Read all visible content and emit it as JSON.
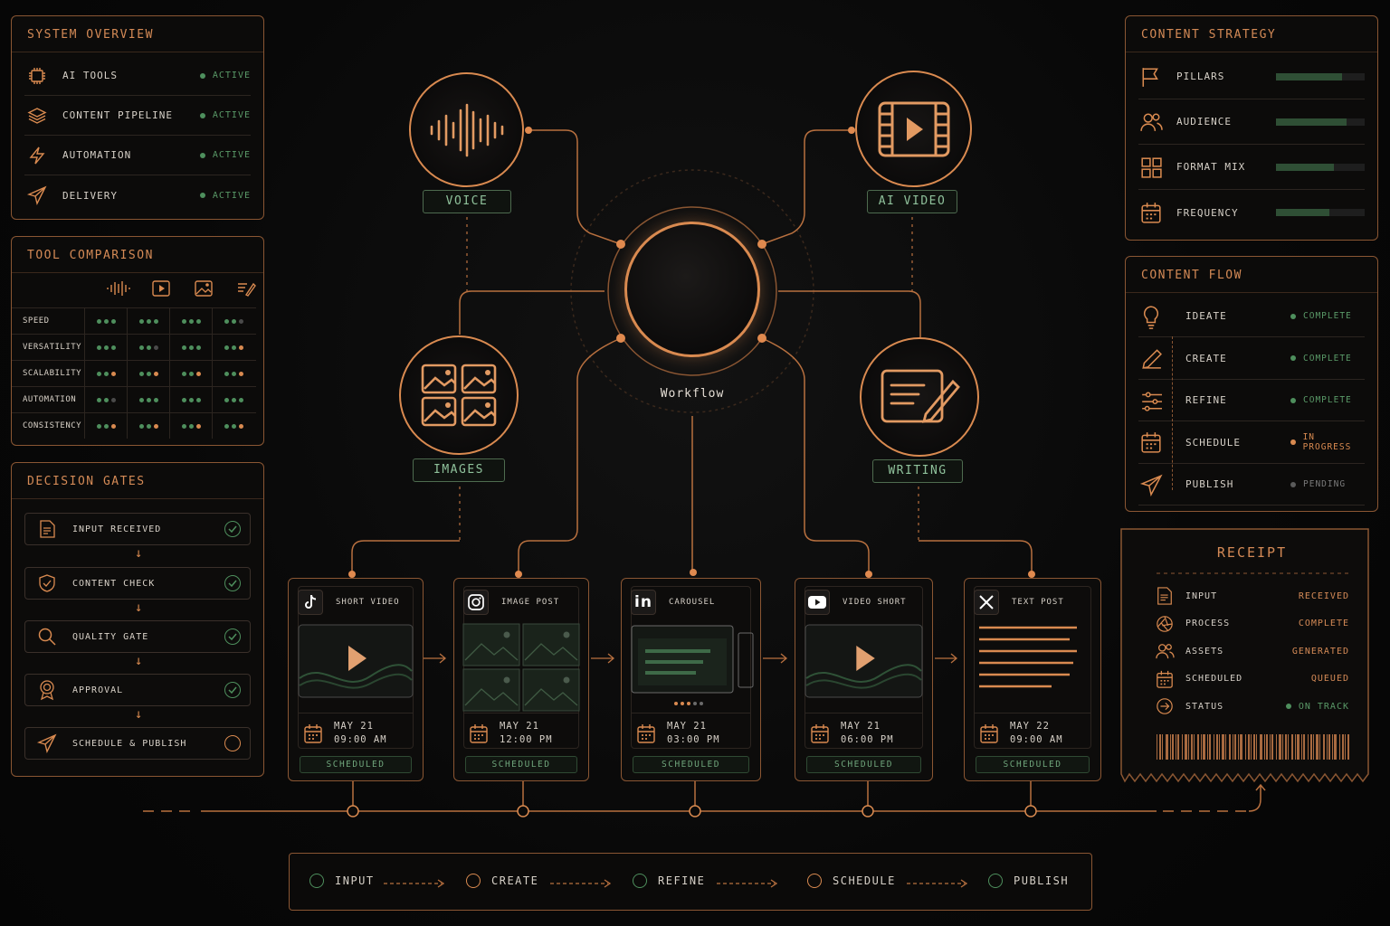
{
  "system_overview": {
    "title": "SYSTEM OVERVIEW",
    "items": [
      {
        "label": "AI TOOLS",
        "status": "ACTIVE",
        "icon": "chip-icon"
      },
      {
        "label": "CONTENT PIPELINE",
        "status": "ACTIVE",
        "icon": "layers-icon"
      },
      {
        "label": "AUTOMATION",
        "status": "ACTIVE",
        "icon": "bolt-icon"
      },
      {
        "label": "DELIVERY",
        "status": "ACTIVE",
        "icon": "send-icon"
      }
    ]
  },
  "tool_comparison": {
    "title": "TOOL COMPARISON",
    "columns": [
      "voice-icon",
      "video-icon",
      "image-icon",
      "writing-icon"
    ],
    "rows": [
      {
        "label": "SPEED",
        "cells": [
          "ggg",
          "ggg",
          "ggg",
          "ggx"
        ]
      },
      {
        "label": "VERSATILITY",
        "cells": [
          "ggg",
          "ggx",
          "ggg",
          "ggo"
        ]
      },
      {
        "label": "SCALABILITY",
        "cells": [
          "ggo",
          "ggo",
          "ggo",
          "ggo"
        ]
      },
      {
        "label": "AUTOMATION",
        "cells": [
          "ggx",
          "ggg",
          "ggg",
          "ggg"
        ]
      },
      {
        "label": "CONSISTENCY",
        "cells": [
          "ggo",
          "ggo",
          "ggo",
          "ggo"
        ]
      }
    ]
  },
  "decision_gates": {
    "title": "DECISION GATES",
    "items": [
      {
        "label": "INPUT RECEIVED",
        "done": true,
        "icon": "document-icon"
      },
      {
        "label": "CONTENT CHECK",
        "done": true,
        "icon": "shield-icon"
      },
      {
        "label": "QUALITY GATE",
        "done": true,
        "icon": "search-icon"
      },
      {
        "label": "APPROVAL",
        "done": true,
        "icon": "badge-icon"
      },
      {
        "label": "SCHEDULE & PUBLISH",
        "done": false,
        "icon": "send-icon"
      }
    ]
  },
  "hub": {
    "center_label": "Workflow",
    "nodes": [
      {
        "label": "VOICE",
        "icon": "waveform-icon"
      },
      {
        "label": "AI VIDEO",
        "icon": "film-icon"
      },
      {
        "label": "IMAGES",
        "icon": "gallery-icon"
      },
      {
        "label": "WRITING",
        "icon": "edit-document-icon"
      }
    ]
  },
  "content_strategy": {
    "title": "CONTENT STRATEGY",
    "items": [
      {
        "label": "PILLARS",
        "level": 0.74,
        "icon": "flag-icon"
      },
      {
        "label": "AUDIENCE",
        "level": 0.8,
        "icon": "users-icon"
      },
      {
        "label": "FORMAT MIX",
        "level": 0.65,
        "icon": "grid-icon"
      },
      {
        "label": "FREQUENCY",
        "level": 0.6,
        "icon": "calendar-icon"
      }
    ]
  },
  "content_flow": {
    "title": "CONTENT FLOW",
    "items": [
      {
        "label": "IDEATE",
        "status": "COMPLETE",
        "state": "complete",
        "icon": "bulb-icon"
      },
      {
        "label": "CREATE",
        "status": "COMPLETE",
        "state": "complete",
        "icon": "pencil-icon"
      },
      {
        "label": "REFINE",
        "status": "COMPLETE",
        "state": "complete",
        "icon": "sliders-icon"
      },
      {
        "label": "SCHEDULE",
        "status": "IN PROGRESS",
        "state": "progress",
        "icon": "calendar-icon"
      },
      {
        "label": "PUBLISH",
        "status": "PENDING",
        "state": "pending",
        "icon": "send-icon"
      }
    ]
  },
  "receipt": {
    "title": "RECEIPT",
    "items": [
      {
        "label": "INPUT",
        "value": "RECEIVED",
        "icon": "document-icon"
      },
      {
        "label": "PROCESS",
        "value": "COMPLETE",
        "icon": "aperture-icon"
      },
      {
        "label": "ASSETS",
        "value": "GENERATED",
        "icon": "users-icon"
      },
      {
        "label": "SCHEDULED",
        "value": "QUEUED",
        "icon": "calendar-icon"
      },
      {
        "label": "STATUS",
        "value": "ON TRACK",
        "icon": "login-icon"
      }
    ]
  },
  "posts": [
    {
      "platform_icon": "tiktok-icon",
      "type": "SHORT VIDEO",
      "date": "MAY 21",
      "time": "09:00 AM",
      "status": "SCHEDULED"
    },
    {
      "platform_icon": "instagram-icon",
      "type": "IMAGE POST",
      "date": "MAY 21",
      "time": "12:00 PM",
      "status": "SCHEDULED"
    },
    {
      "platform_icon": "linkedin-icon",
      "type": "CAROUSEL",
      "date": "MAY 21",
      "time": "03:00 PM",
      "status": "SCHEDULED"
    },
    {
      "platform_icon": "youtube-icon",
      "type": "VIDEO SHORT",
      "date": "MAY 21",
      "time": "06:00 PM",
      "status": "SCHEDULED"
    },
    {
      "platform_icon": "x-icon",
      "type": "TEXT POST",
      "date": "MAY 22",
      "time": "09:00 AM",
      "status": "SCHEDULED"
    }
  ],
  "pipeline_steps": [
    "INPUT",
    "CREATE",
    "REFINE",
    "SCHEDULE",
    "PUBLISH"
  ],
  "colors": {
    "accent": "#d98a50",
    "green": "#4e8f5d",
    "panel_border": "#8a5633"
  }
}
